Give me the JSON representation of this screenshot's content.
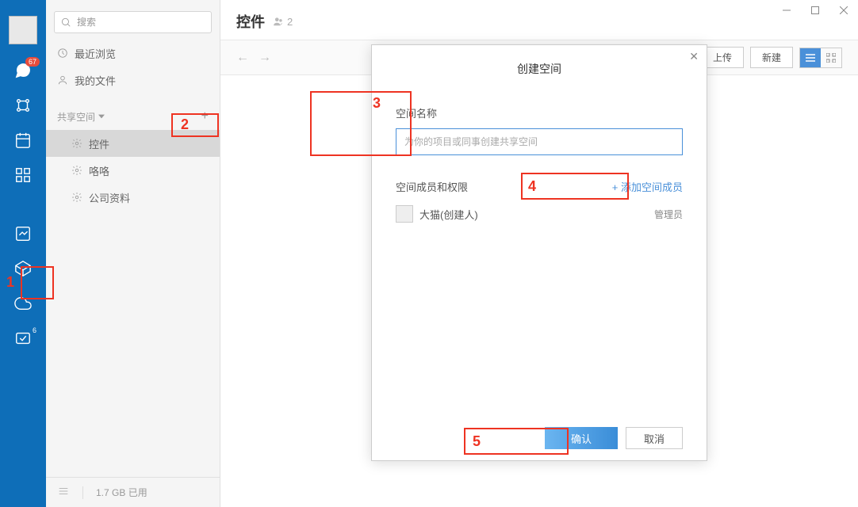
{
  "rail": {
    "chat_badge": "67",
    "share_sup": "6"
  },
  "sidebar": {
    "search_placeholder": "搜索",
    "recent_label": "最近浏览",
    "myfiles_label": "我的文件",
    "shared_header": "共享空间",
    "items": [
      {
        "label": "控件"
      },
      {
        "label": "咯咯"
      },
      {
        "label": "公司资料"
      }
    ],
    "storage": "1.7 GB 已用"
  },
  "header": {
    "title": "控件",
    "member_count": "2"
  },
  "toolbar": {
    "upload": "上传",
    "create": "新建"
  },
  "modal": {
    "title": "创建空间",
    "name_label": "空间名称",
    "name_placeholder": "为你的项目或同事创建共享空间",
    "members_label": "空间成员和权限",
    "add_member": "+ 添加空间成员",
    "member_name": "大猫(创建人)",
    "member_role": "管理员",
    "confirm": "确认",
    "cancel": "取消"
  },
  "annotations": {
    "a1": "1",
    "a2": "2",
    "a3": "3",
    "a4": "4",
    "a5": "5"
  }
}
